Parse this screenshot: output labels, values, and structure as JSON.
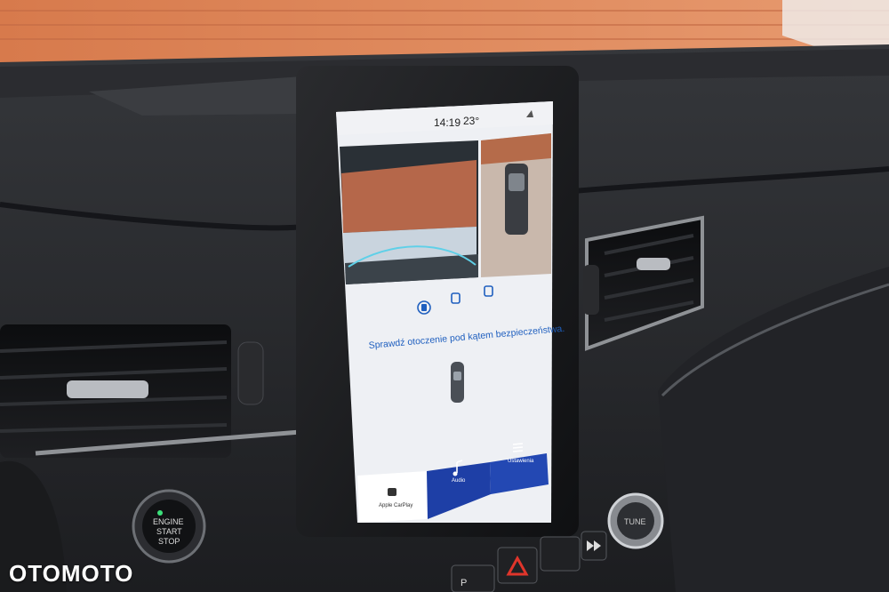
{
  "screen": {
    "time": "14:19",
    "temperature": "23°",
    "status_icon": "signal-icon",
    "message": "Sprawdź otoczenie pod kątem bezpieczeństwa.",
    "camera_mode_icons": [
      "front-camera-icon",
      "top-view-camera-icon",
      "side-camera-icon"
    ],
    "nav": [
      {
        "label": "Apple CarPlay",
        "icon": "carplay-icon"
      },
      {
        "label": "Audio",
        "icon": "music-note-icon"
      },
      {
        "label": "Ustawienia",
        "icon": "menu-icon"
      }
    ],
    "colors": {
      "header_bg": "#f1f2f5",
      "text": "#1f5fbf",
      "nav_active": "#1e3fa6",
      "screen_bg": "#eef0f4"
    }
  },
  "dashboard": {
    "engine_button": {
      "line1": "ENGINE",
      "line2": "START",
      "line3": "STOP"
    },
    "knob_label": "TUNE",
    "buttons": [
      "P",
      "hazard-icon",
      "",
      "fast-forward-icon"
    ]
  },
  "watermark": "OTOMOTO"
}
